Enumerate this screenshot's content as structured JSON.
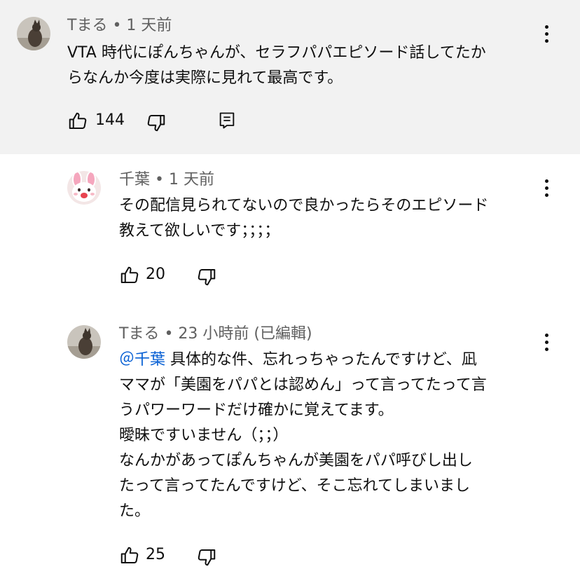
{
  "comments": [
    {
      "author": "Tまる",
      "time": "1 天前",
      "text": "VTA 時代にぽんちゃんが、セラフパパエピソード話してたか\nらなんか今度は実際に見れて最高です。",
      "likes": "144"
    },
    {
      "author": "千葉",
      "time": "1 天前",
      "text": "その配信見られてないので良かったらそのエピソード\n教えて欲しいです；；；；",
      "likes": "20"
    },
    {
      "author": "Tまる",
      "time": "23 小時前 (已編輯)",
      "mention": "＠千葉",
      "text": "  具体的な件、忘れっちゃったんですけど、凪\nママが「美園をパパとは認めん」って言ってたって言\nうパワーワードだけ確かに覚えてます。\n曖昧ですいません（；；）\nなんかがあってぽんちゃんが美園をパパ呼びし出し\nたって言ってたんですけど、そこ忘れてしまいまし\nた。",
      "likes": "25"
    }
  ],
  "separator": " • ",
  "icons": {
    "like": "thumbs-up-icon",
    "dislike": "thumbs-down-icon",
    "reply": "reply-icon",
    "more": "more-vert-icon"
  },
  "colors": {
    "highlight_bg": "#f2f2f2",
    "meta_text": "#606060",
    "mention": "#065fd4"
  }
}
